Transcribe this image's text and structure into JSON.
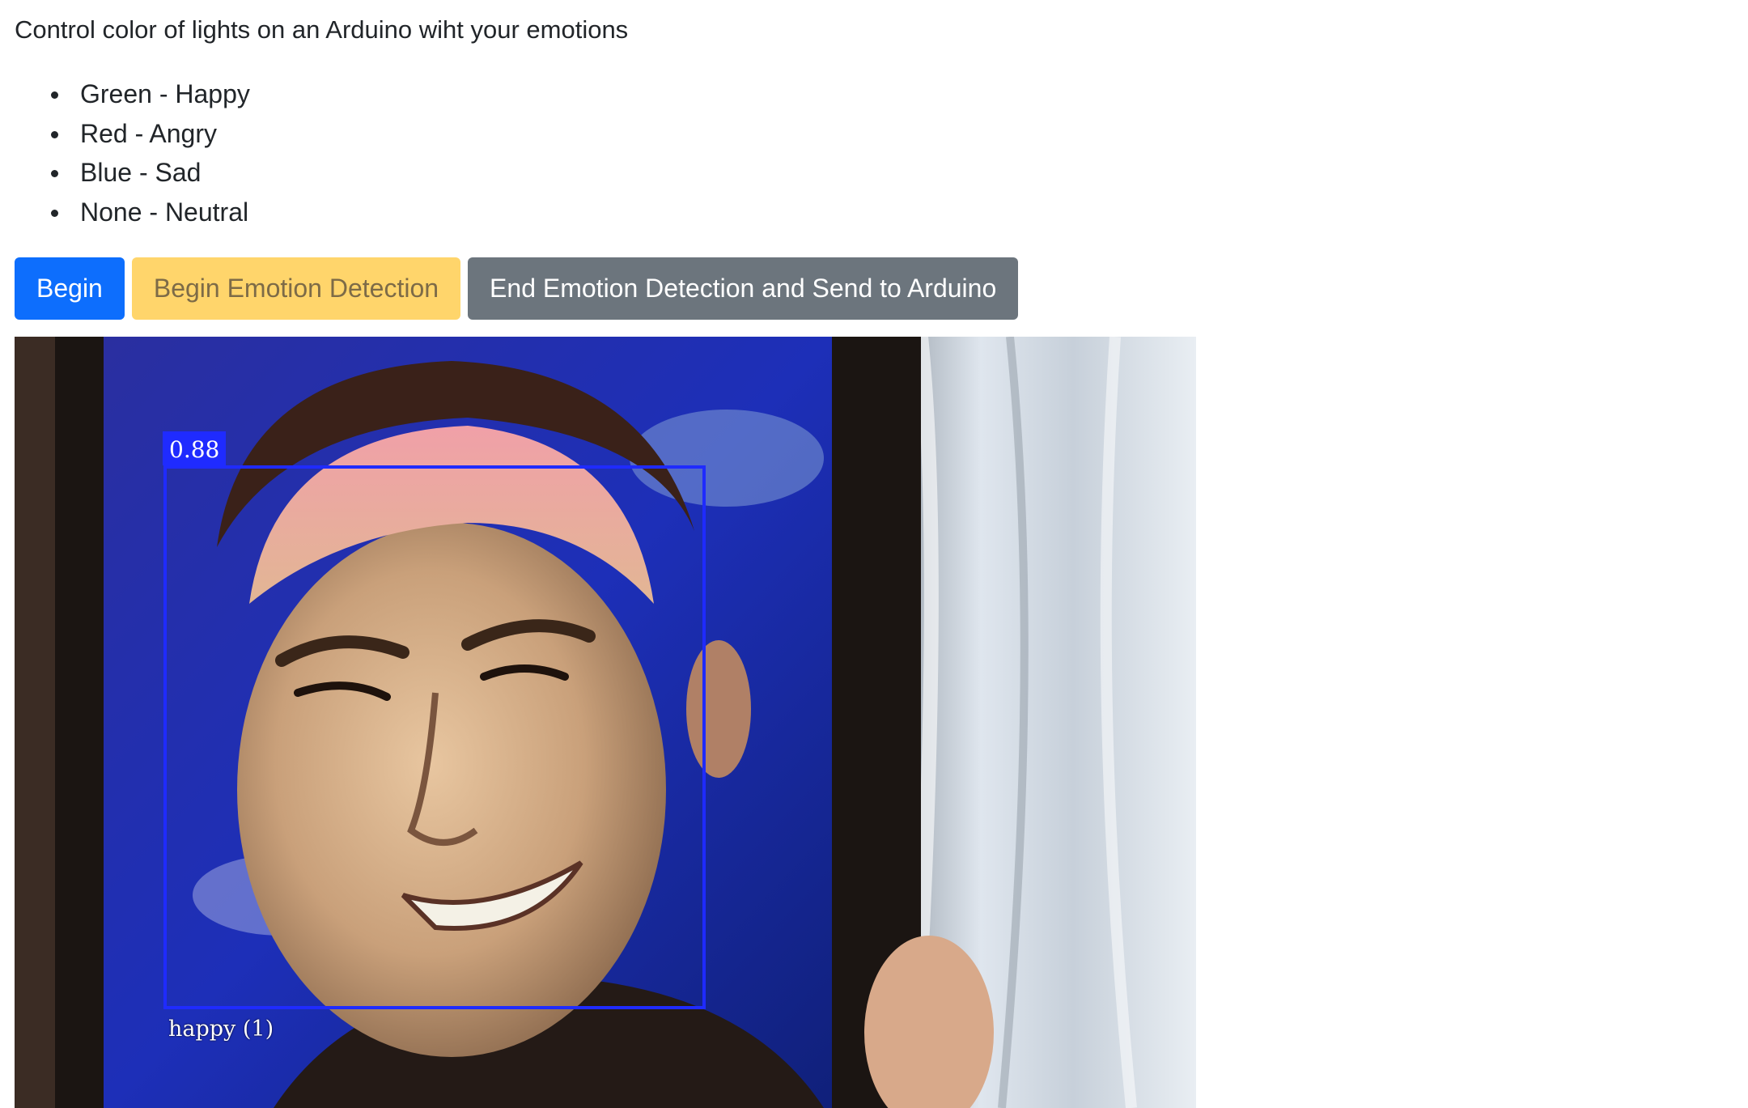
{
  "intro": "Control color of lights on an Arduino wiht your emotions",
  "legend": [
    {
      "text": "Green - Happy"
    },
    {
      "text": "Red - Angry"
    },
    {
      "text": "Blue - Sad"
    },
    {
      "text": "None - Neutral"
    }
  ],
  "buttons": {
    "begin": "Begin",
    "begin_detection": "Begin Emotion Detection",
    "end_detection": "End Emotion Detection and Send to Arduino"
  },
  "colors": {
    "primary": "#0d6efd",
    "warning": "#ffd56b",
    "secondary": "#6c757d",
    "detection_box": "#1f2bff"
  },
  "detection": {
    "score": "0.88",
    "label": "happy (1)"
  }
}
